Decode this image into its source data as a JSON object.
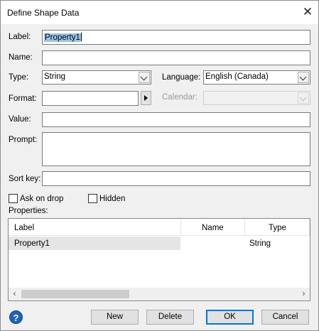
{
  "window": {
    "title": "Define Shape Data",
    "close_glyph": "✕"
  },
  "form": {
    "label_label": "Label:",
    "label_value": "Property1",
    "name_label": "Name:",
    "name_value": "",
    "type_label": "Type:",
    "type_value": "String",
    "language_label": "Language:",
    "language_value": "English (Canada)",
    "format_label": "Format:",
    "format_value": "",
    "calendar_label": "Calendar:",
    "calendar_value": "",
    "value_label": "Value:",
    "value_value": "",
    "prompt_label": "Prompt:",
    "prompt_value": "",
    "sort_key_label": "Sort key:",
    "sort_key_value": ""
  },
  "options": {
    "ask_on_drop": {
      "label": "Ask on drop",
      "checked": false
    },
    "hidden": {
      "label": "Hidden",
      "checked": false
    }
  },
  "properties": {
    "heading": "Properties:",
    "columns": [
      "Label",
      "Name",
      "Type"
    ],
    "rows": [
      {
        "label": "Property1",
        "name": "",
        "type": "String"
      }
    ]
  },
  "buttons": {
    "help": "?",
    "new": "New",
    "delete": "Delete",
    "ok": "OK",
    "cancel": "Cancel"
  },
  "scrollbar": {
    "left_glyph": "‹",
    "right_glyph": "›"
  },
  "colors": {
    "selection": "#9cc3ea",
    "default_button_border": "#0078d7",
    "help_icon": "#1f64b4",
    "dialog_bg": "#f0f0f0"
  }
}
